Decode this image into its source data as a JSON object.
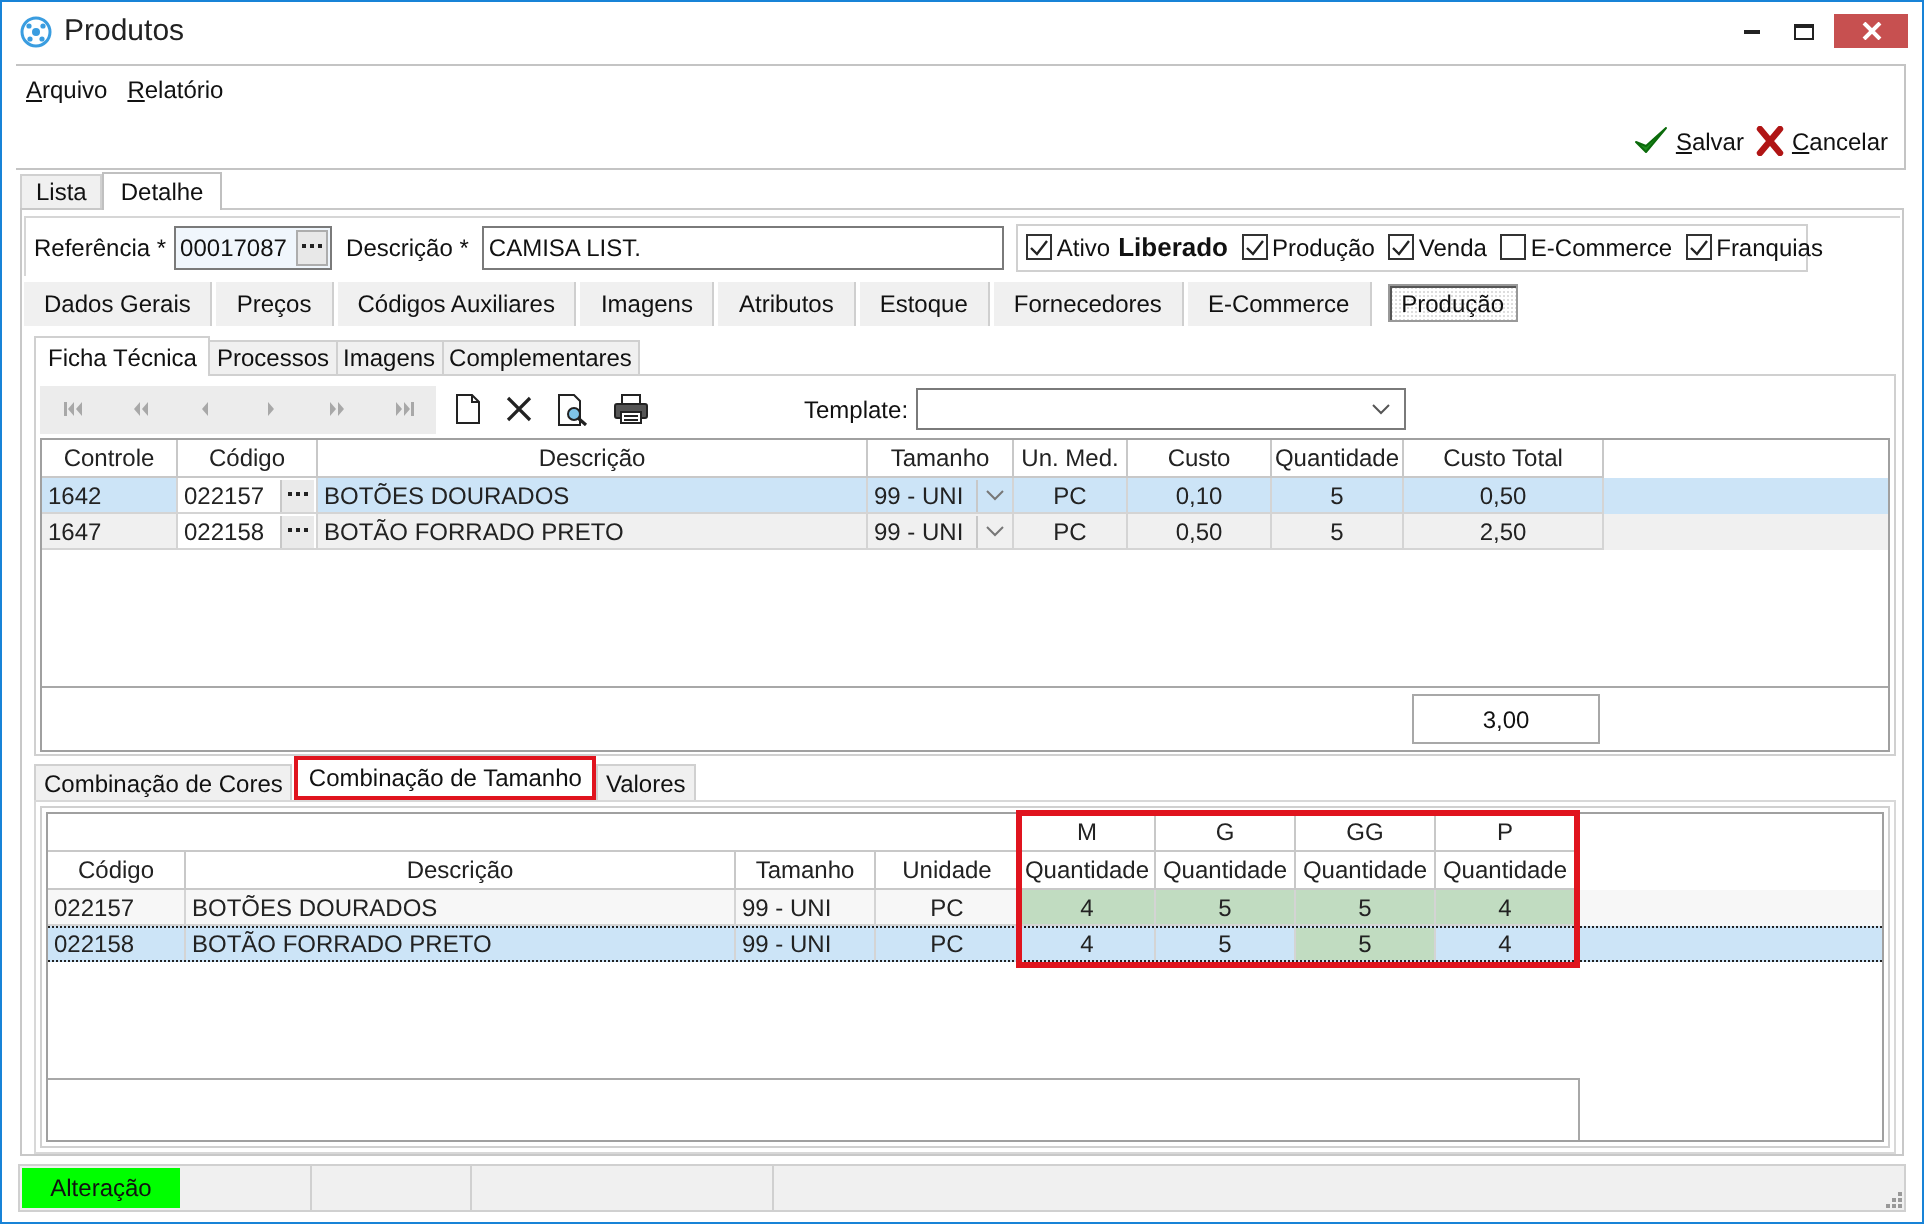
{
  "window": {
    "title": "Produtos"
  },
  "menu": [
    {
      "label": "Arquivo"
    },
    {
      "label": "Relatório"
    }
  ],
  "actions": [
    {
      "kind": "save",
      "label": "Salvar"
    },
    {
      "kind": "cancel",
      "label": "Cancelar"
    }
  ],
  "view_tabs": [
    {
      "label": "Lista",
      "selected": false
    },
    {
      "label": "Detalhe",
      "selected": true
    }
  ],
  "reference": {
    "label": "Referência *",
    "value": "00017087"
  },
  "description": {
    "label": "Descrição *",
    "value": "CAMISA LIST."
  },
  "flags": [
    {
      "kind": "checkbox",
      "label": "Ativo",
      "checked": true
    },
    {
      "kind": "status",
      "label": "Liberado"
    },
    {
      "kind": "checkbox",
      "label": "Produção",
      "checked": true
    },
    {
      "kind": "checkbox",
      "label": "Venda",
      "checked": true
    },
    {
      "kind": "checkbox",
      "label": "E-Commerce",
      "checked": false
    },
    {
      "kind": "checkbox",
      "label": "Franquias",
      "checked": true
    }
  ],
  "section_tabs": [
    {
      "label": "Dados Gerais",
      "selected": false
    },
    {
      "label": "Preços",
      "selected": false
    },
    {
      "label": "Códigos Auxiliares",
      "selected": false
    },
    {
      "label": "Imagens",
      "selected": false
    },
    {
      "label": "Atributos",
      "selected": false
    },
    {
      "label": "Estoque",
      "selected": false
    },
    {
      "label": "Fornecedores",
      "selected": false
    },
    {
      "label": "E-Commerce",
      "selected": false
    },
    {
      "label": "Produção",
      "selected": true
    }
  ],
  "sub_tabs": [
    {
      "label": "Ficha Técnica",
      "selected": true
    },
    {
      "label": "Processos",
      "selected": false
    },
    {
      "label": "Imagens",
      "selected": false
    },
    {
      "label": "Complementares",
      "selected": false
    }
  ],
  "navigator": {
    "disabled": true
  },
  "template": {
    "label": "Template:"
  },
  "components": {
    "columns": [
      "Controle",
      "Código",
      "Descrição",
      "Tamanho",
      "Un. Med.",
      "Custo",
      "Quantidade",
      "Custo Total"
    ],
    "rows": [
      {
        "selected": true,
        "cells": [
          "1642",
          "022157",
          "BOTÕES DOURADOS",
          "99 - UNI",
          "PC",
          "0,10",
          "5",
          "0,50"
        ]
      },
      {
        "selected": false,
        "cells": [
          "1647",
          "022158",
          "BOTÃO FORRADO PRETO",
          "99 - UNI",
          "PC",
          "0,50",
          "5",
          "2,50"
        ]
      }
    ],
    "total": "3,00"
  },
  "combination_tabs": [
    {
      "label": "Combinação de Cores",
      "selected": false,
      "outlined": false
    },
    {
      "label": "Combinação de Tamanho",
      "selected": true,
      "outlined": true
    },
    {
      "label": "Valores",
      "selected": false,
      "outlined": false
    }
  ],
  "size_table": {
    "columns": [
      "Código",
      "Descrição",
      "Tamanho",
      "Unidade"
    ],
    "outlined": true,
    "sizes": [
      {
        "size": "M",
        "column": "Quantidade"
      },
      {
        "size": "G",
        "column": "Quantidade"
      },
      {
        "size": "GG",
        "column": "Quantidade"
      },
      {
        "size": "P",
        "column": "Quantidade"
      }
    ],
    "rows": [
      {
        "selected": false,
        "cells": [
          "022157",
          "BOTÕES DOURADOS",
          "99 - UNI",
          "PC"
        ],
        "quantities": [
          {
            "value": "4",
            "highlighted": true
          },
          {
            "value": "5",
            "highlighted": true
          },
          {
            "value": "5",
            "highlighted": true
          },
          {
            "value": "4",
            "highlighted": true
          }
        ]
      },
      {
        "selected": true,
        "cells": [
          "022158",
          "BOTÃO FORRADO PRETO",
          "99 - UNI",
          "PC"
        ],
        "quantities": [
          {
            "value": "4",
            "highlighted": false
          },
          {
            "value": "5",
            "highlighted": false
          },
          {
            "value": "5",
            "highlighted": true
          },
          {
            "value": "4",
            "highlighted": false
          }
        ]
      }
    ]
  },
  "status_bar": {
    "mode": "Alteração",
    "highlighted": true
  }
}
